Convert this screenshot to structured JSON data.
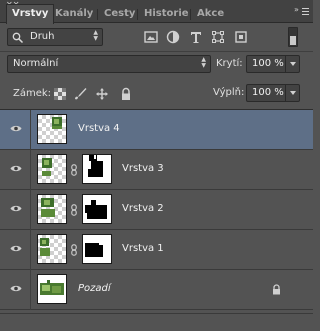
{
  "tabs": [
    {
      "label": "Vrstvy",
      "active": true
    },
    {
      "label": "Kanály",
      "active": false
    },
    {
      "label": "Cesty",
      "active": false
    },
    {
      "label": "Historie",
      "active": false
    },
    {
      "label": "Akce",
      "active": false
    }
  ],
  "filter": {
    "kind_label": "Druh",
    "icons": [
      "image-filter-icon",
      "adjustment-filter-icon",
      "type-filter-icon",
      "shape-filter-icon",
      "smart-object-filter-icon"
    ]
  },
  "blend": {
    "mode": "Normální",
    "opacity_label": "Krytí:",
    "opacity_value": "100 %"
  },
  "lock": {
    "label": "Zámek:",
    "fill_label": "Výplň:",
    "fill_value": "100 %"
  },
  "layers": [
    {
      "name": "Vrstva 4",
      "selected": true,
      "has_mask": false
    },
    {
      "name": "Vrstva 3",
      "selected": false,
      "has_mask": true
    },
    {
      "name": "Vrstva 2",
      "selected": false,
      "has_mask": true
    },
    {
      "name": "Vrstva 1",
      "selected": false,
      "has_mask": true
    },
    {
      "name": "Pozadí",
      "selected": false,
      "has_mask": false,
      "locked": true,
      "italic": true
    }
  ],
  "colors": {
    "selected_row": "#5e6f87",
    "panel_bg": "#535353",
    "tab_bar": "#424242"
  }
}
